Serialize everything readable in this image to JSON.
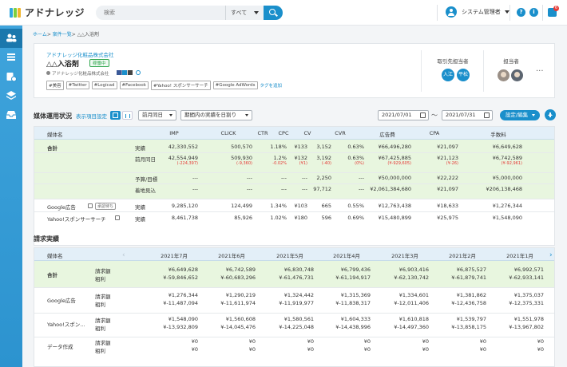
{
  "header": {
    "logo_text": "アドナレッジ",
    "search_placeholder": "検索",
    "search_scope": "すべて",
    "user_name": "システム管理者",
    "help_icon_label": "?",
    "info_icon_label": "i",
    "notification_count": "6"
  },
  "breadcrumb": {
    "home": "ホーム",
    "list": "案件一覧",
    "current": "△△入浴剤",
    "sep": ">"
  },
  "campaign": {
    "company": "アドナレッジ化粧品株式会社",
    "name": "△△入浴剤",
    "status": "稼働中",
    "corp_line": "アドナレッジ化粧品株式会社",
    "tags": [
      "#美容",
      "#Twitter",
      "#Logicad",
      "#Facebook",
      "#Yahoo! スポンサーサーチ",
      "#Google AdWords"
    ],
    "add_tag": "タグを追加",
    "client_rep_label": "取引先担当者",
    "client_reps": [
      "入江",
      "平松"
    ],
    "owner_label": "担当者",
    "more": "..."
  },
  "media_section": {
    "title": "媒体運用状況",
    "setting_link": "表示項目設定",
    "compare_select": "前月同日",
    "period_select": "期間内の実績を日割り",
    "date_from": "2021/07/01",
    "date_to": "2021/07/31",
    "tilde": "〜",
    "settings_button": "設定/編集",
    "headers": [
      "媒体名",
      "IMP",
      "CLICK",
      "CTR",
      "CPC",
      "CV",
      "CVR",
      "広告費",
      "CPA",
      "手数料"
    ],
    "total_label": "合計",
    "rows": [
      {
        "kind": "実績",
        "vals": [
          "42,330,552",
          "500,570",
          "1.18%",
          "¥133",
          "3,152",
          "0.63%",
          "¥66,496,280",
          "¥21,097",
          "¥6,649,628"
        ]
      },
      {
        "kind": "前月同日",
        "vals": [
          "42,554,949",
          "509,930",
          "1.2%",
          "¥132",
          "3,192",
          "0.63%",
          "¥67,425,885",
          "¥21,123",
          "¥6,742,589"
        ],
        "diff": [
          "(-224,397)",
          "(-9,360)",
          "-0.02%",
          "(¥1)",
          "(-40)",
          "(0%)",
          "(¥-929,605)",
          "(¥-26)",
          "(¥-92,961)"
        ]
      },
      {
        "kind": "予算/目標",
        "vals": [
          "---",
          "---",
          "---",
          "---",
          "2,250",
          "---",
          "¥50,000,000",
          "¥22,222",
          "¥5,000,000"
        ]
      },
      {
        "kind": "着地見込",
        "vals": [
          "---",
          "---",
          "---",
          "---",
          "97,712",
          "---",
          "¥2,061,384,680",
          "¥21,097",
          "¥206,138,468"
        ]
      }
    ],
    "media_rows": [
      {
        "name": "Google広告",
        "badge": "承認待ち",
        "kind": "実績",
        "vals": [
          "9,285,120",
          "124,499",
          "1.34%",
          "¥103",
          "665",
          "0.55%",
          "¥12,763,438",
          "¥18,633",
          "¥1,276,344"
        ]
      },
      {
        "name": "Yahoo!スポンサーサーチ",
        "badge": "",
        "kind": "実績",
        "vals": [
          "8,461,738",
          "85,926",
          "1.02%",
          "¥180",
          "596",
          "0.69%",
          "¥15,480,899",
          "¥25,975",
          "¥1,548,090"
        ]
      }
    ]
  },
  "billing_section": {
    "title": "請求実績",
    "media_header": "媒体名",
    "months": [
      "2021年7月",
      "2021年6月",
      "2021年5月",
      "2021年4月",
      "2021年3月",
      "2021年2月",
      "2021年1月"
    ],
    "prev_arrow": "‹",
    "next_arrow": "›",
    "rows": [
      {
        "name": "合計",
        "labels": [
          "請求額",
          "粗利"
        ],
        "billing": [
          "¥6,649,628",
          "¥6,742,589",
          "¥6,830,748",
          "¥6,799,436",
          "¥6,903,416",
          "¥6,875,527",
          "¥6,992,571"
        ],
        "profit": [
          "¥-59,846,652",
          "¥-60,683,296",
          "¥-61,476,731",
          "¥-61,194,917",
          "¥-62,130,742",
          "¥-61,879,741",
          "¥-62,933,141"
        ]
      },
      {
        "name": "Google広告",
        "labels": [
          "請求額",
          "粗利"
        ],
        "billing": [
          "¥1,276,344",
          "¥1,290,219",
          "¥1,324,442",
          "¥1,315,369",
          "¥1,334,601",
          "¥1,381,862",
          "¥1,375,037"
        ],
        "profit": [
          "¥-11,487,094",
          "¥-11,611,974",
          "¥-11,919,977",
          "¥-11,838,317",
          "¥-12,011,406",
          "¥-12,436,758",
          "¥-12,375,331"
        ]
      },
      {
        "name": "Yahoo!スポン...",
        "labels": [
          "請求額",
          "粗利"
        ],
        "billing": [
          "¥1,548,090",
          "¥1,560,608",
          "¥1,580,561",
          "¥1,604,333",
          "¥1,610,818",
          "¥1,539,797",
          "¥1,551,978"
        ],
        "profit": [
          "¥-13,932,809",
          "¥-14,045,476",
          "¥-14,225,048",
          "¥-14,438,996",
          "¥-14,497,360",
          "¥-13,858,175",
          "¥-13,967,802"
        ]
      },
      {
        "name": "データ作成",
        "labels": [
          "請求額",
          "粗利"
        ],
        "billing": [
          "¥0",
          "¥0",
          "¥0",
          "¥0",
          "¥0",
          "¥0",
          "¥0"
        ],
        "profit": [
          "¥0",
          "¥0",
          "¥0",
          "¥0",
          "¥0",
          "¥0",
          "¥0"
        ]
      }
    ]
  },
  "colors": {
    "accent": "#1a8fcb",
    "sidebar": "#3fa4dc",
    "total_row": "#e8f6df",
    "table_header": "#e3eff8",
    "negative": "#e53935"
  }
}
